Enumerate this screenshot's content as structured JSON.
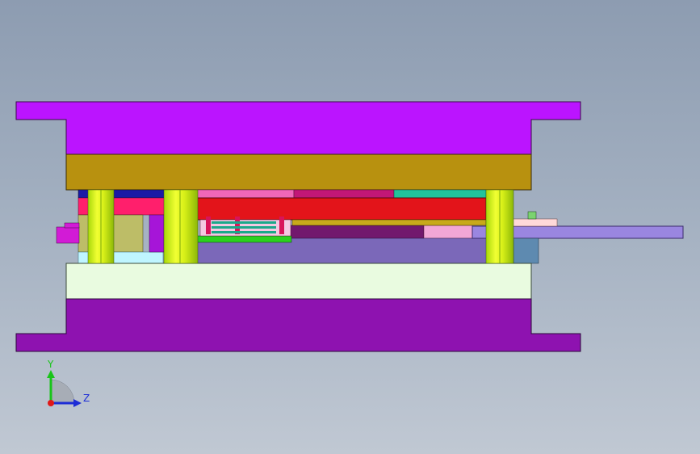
{
  "viewport": {
    "background_top": "#8d9cb1",
    "background_bottom": "#c0c8d3"
  },
  "model": {
    "colors": {
      "top_plate": "#bb14ff",
      "punch_holder": "#b8910f",
      "blue_strip": "#1a1aa5",
      "pink_strip": "#f067b8",
      "magenta_strip": "#c21777",
      "teal_strip": "#22c39c",
      "stripper_plate": "#e3141a",
      "pink_backing": "#ff1f6c",
      "die_block": "#7b68b9",
      "strip_material": "#9a86e0",
      "lower_plate": "#e9fbe0",
      "bottom_base": "#8e12b0",
      "guide_pillar": "#ccff11",
      "side_block": "#bdbd67",
      "steel_blue_block": "#5e8ab0",
      "green_plate": "#2bd11f",
      "cyan_plate": "#bff5ff",
      "light_pink": "#ffd9d9",
      "dark_purple": "#72186d"
    }
  },
  "triad": {
    "y_label": "Y",
    "z_label": "Z",
    "y_color": "#18c418",
    "z_color": "#1d2dd6",
    "x_color": "#e01818"
  }
}
